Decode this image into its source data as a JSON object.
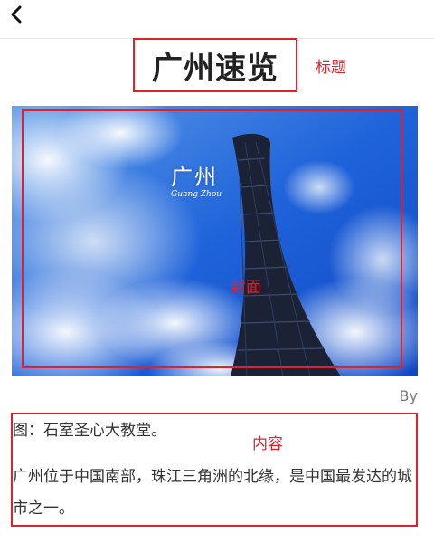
{
  "header": {
    "back_icon": "chevron-left-icon"
  },
  "article": {
    "title": "广州速览",
    "cover": {
      "text_cn": "广州",
      "text_en": "Guang Zhou"
    },
    "byline": "By",
    "caption": "图：石室圣心大教堂。",
    "paragraph": "广州位于中国南部，珠江三角洲的北缘，是中国最发达的城市之一。"
  },
  "annotations": {
    "title": "标题",
    "cover": "封面",
    "content": "内容"
  },
  "colors": {
    "annotation": "#e0202a",
    "sky": "#1a57d6"
  }
}
